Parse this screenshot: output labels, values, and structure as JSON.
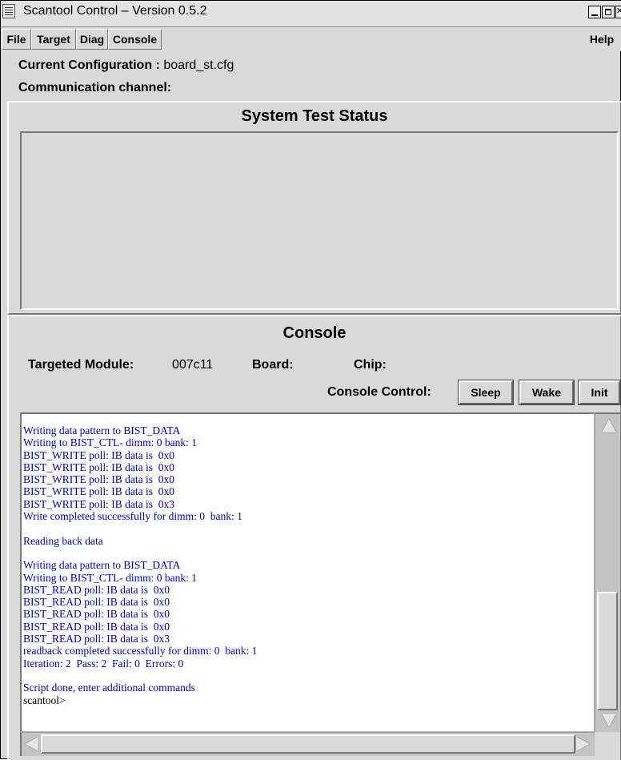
{
  "window": {
    "title": "Scantool Control –  Version 0.5.2"
  },
  "menubar": {
    "file": "File",
    "target": "Target",
    "diag": "Diag",
    "console": "Console",
    "help": "Help"
  },
  "info": {
    "config_label": "Current Configuration :",
    "config_value": "board_st.cfg",
    "channel_label": "Communication channel:",
    "channel_value": ""
  },
  "status": {
    "title": "System Test Status"
  },
  "console": {
    "title": "Console",
    "targeted_module_label": "Targeted Module:",
    "targeted_module_value": "007c11",
    "board_label": "Board:",
    "board_value": "",
    "chip_label": "Chip:",
    "chip_value": "",
    "control_label": "Console Control:",
    "buttons": {
      "sleep": "Sleep",
      "wake": "Wake",
      "init": "Init"
    },
    "lines": [
      "Writing data pattern to BIST_DATA",
      "Writing to BIST_CTL- dimm: 0 bank: 1",
      "BIST_WRITE poll: IB data is  0x0",
      "BIST_WRITE poll: IB data is  0x0",
      "BIST_WRITE poll: IB data is  0x0",
      "BIST_WRITE poll: IB data is  0x0",
      "BIST_WRITE poll: IB data is  0x3",
      "Write completed successfully for dimm: 0  bank: 1",
      "",
      "Reading back data",
      "",
      "Writing data pattern to BIST_DATA",
      "Writing to BIST_CTL- dimm: 0 bank: 1",
      "BIST_READ poll: IB data is  0x0",
      "BIST_READ poll: IB data is  0x0",
      "BIST_READ poll: IB data is  0x0",
      "BIST_READ poll: IB data is  0x0",
      "BIST_READ poll: IB data is  0x3",
      "readback completed successfully for dimm: 0  bank: 1",
      "Iteration: 2  Pass: 2  Fail: 0  Errors: 0",
      "",
      "Script done, enter additional commands"
    ],
    "prompt": "scantool>",
    "text_color": "#0000cc"
  }
}
